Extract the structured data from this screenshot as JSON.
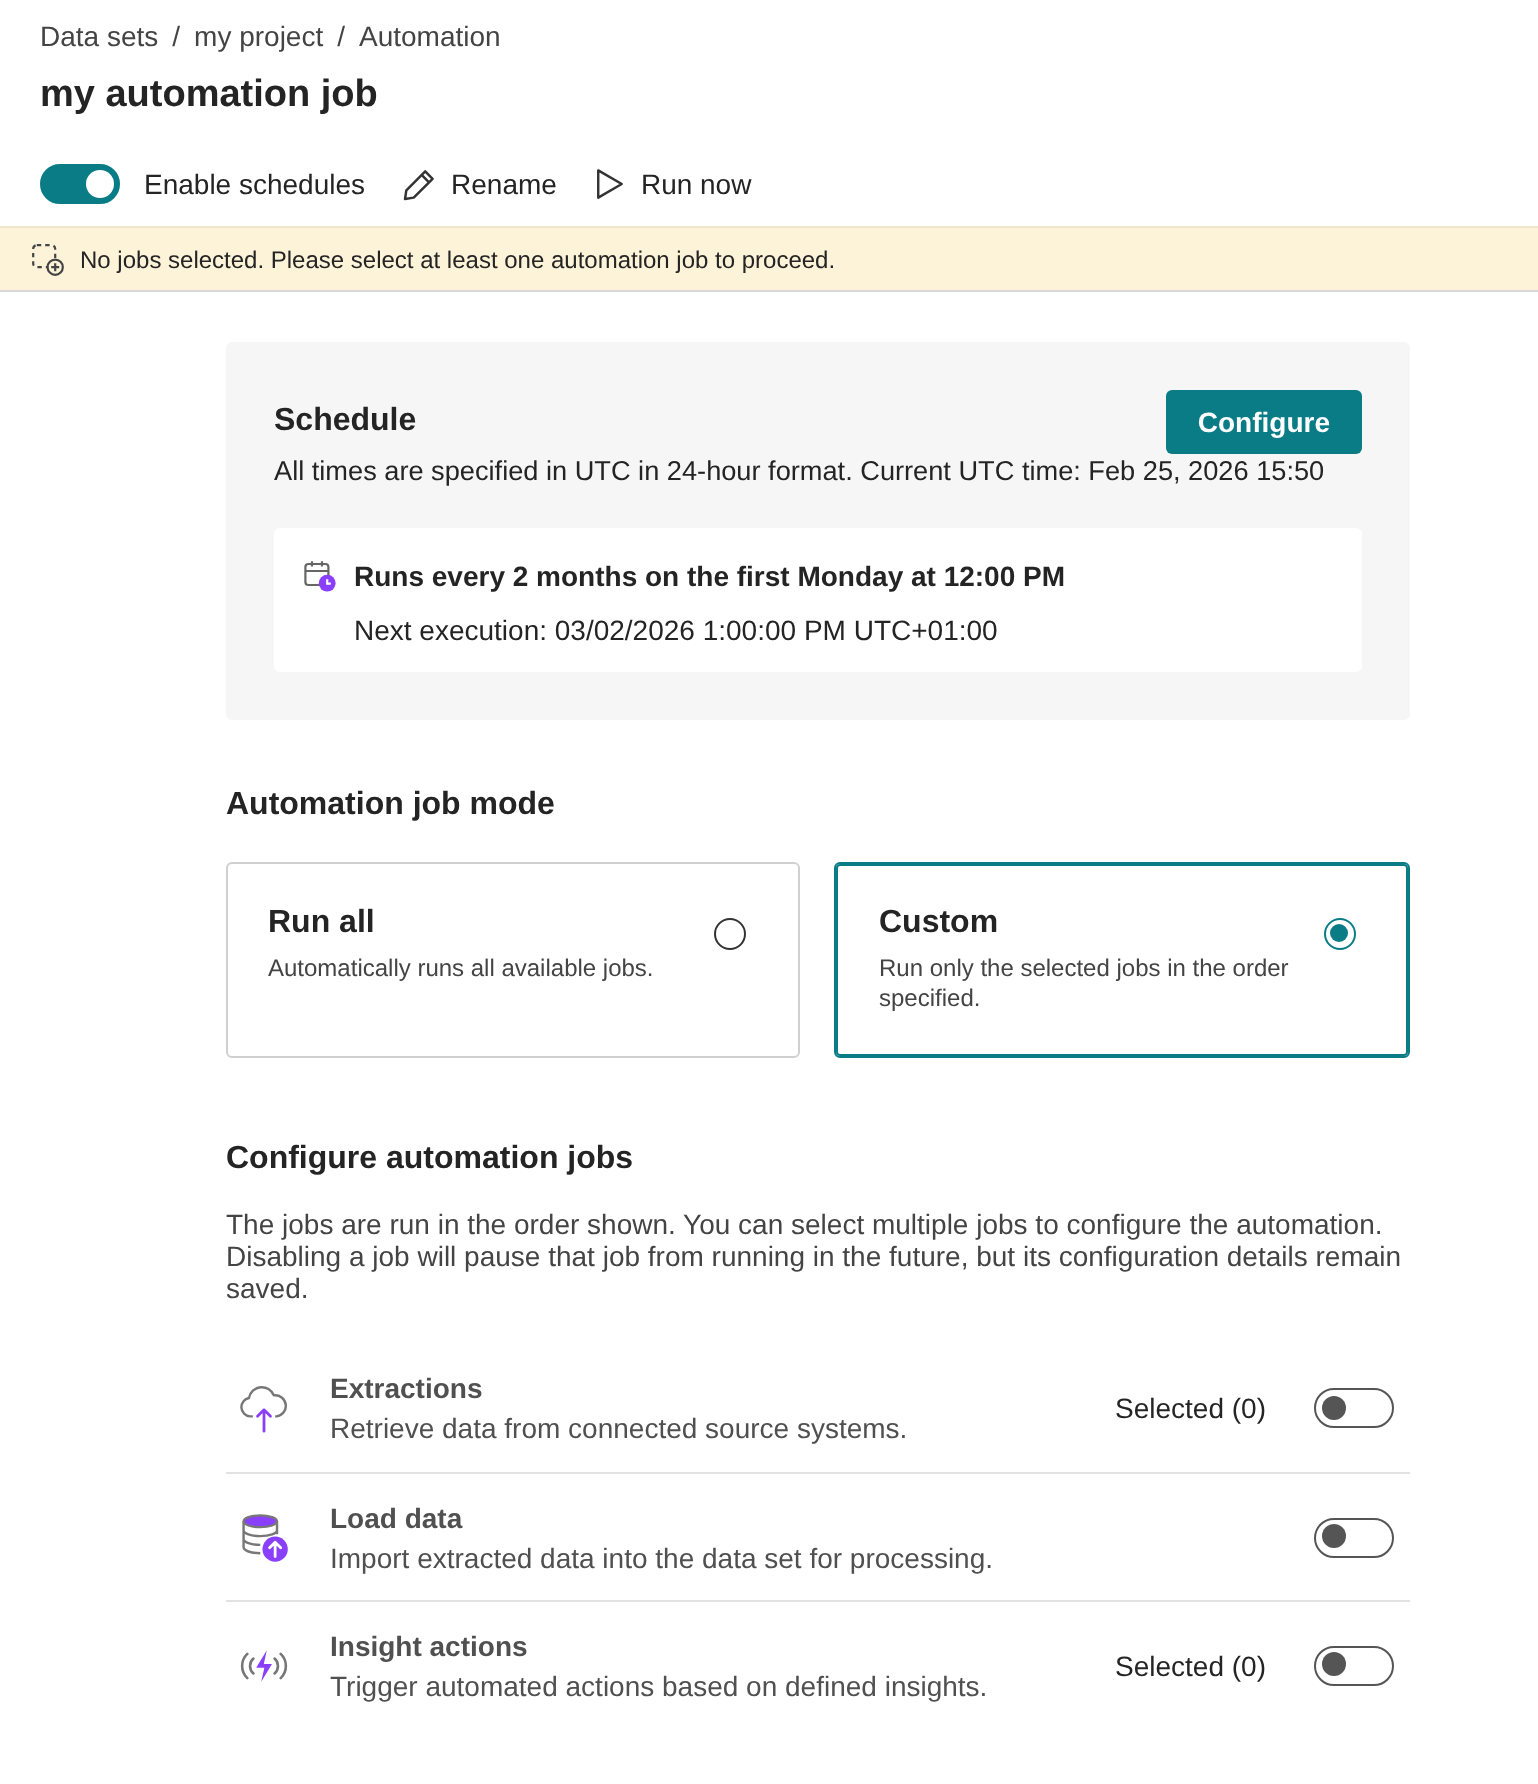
{
  "breadcrumb": [
    {
      "label": "Data sets",
      "separator": "/"
    },
    {
      "label": "my project",
      "separator": "/"
    },
    {
      "label": "Automation"
    }
  ],
  "title": "my automation job",
  "toolbar": {
    "schedule_toggle": {
      "label": "Enable schedules",
      "on": true
    },
    "actions": [
      {
        "kind": "rename",
        "label": "Rename"
      },
      {
        "kind": "run",
        "label": "Run now"
      }
    ]
  },
  "banner": {
    "message": "No jobs selected. Please select at least one automation job to proceed."
  },
  "schedule": {
    "title": "Schedule",
    "button": "Configure",
    "note": "All times are specified in UTC in 24-hour format. Current UTC time: Feb 25, 2026 15:50",
    "rule": "Runs every 2 months on the first Monday at 12:00 PM",
    "next_execution": "Next execution: 03/02/2026 1:00:00 PM UTC+01:00"
  },
  "mode": {
    "title": "Automation job mode",
    "options": [
      {
        "title": "Run all",
        "description": "Automatically runs all available jobs.",
        "selected": false
      },
      {
        "title": "Custom",
        "description": "Run only the selected jobs in the order specified.",
        "selected": true
      }
    ]
  },
  "jobs": {
    "title": "Configure automation jobs",
    "description": "The jobs are run in the order shown. You can select multiple jobs to configure the automation. Disabling a job will pause that job from running in the future, but its configuration details remain saved.",
    "items": [
      {
        "kind": "extractions",
        "title": "Extractions",
        "description": "Retrieve data from connected source systems.",
        "count": "Selected (0)",
        "on": false
      },
      {
        "kind": "load",
        "title": "Load data",
        "description": "Import extracted data into the data set for processing.",
        "on": false
      },
      {
        "kind": "insights",
        "title": "Insight actions",
        "description": "Trigger automated actions based on defined insights.",
        "count": "Selected (0)",
        "on": false
      }
    ]
  }
}
